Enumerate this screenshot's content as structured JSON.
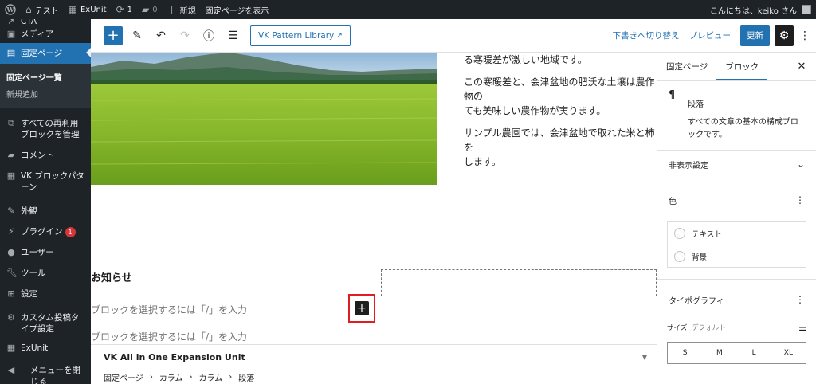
{
  "admin_bar": {
    "wp_logo_icon": "wordpress-logo-icon",
    "site_name": "テスト",
    "exunit": "ExUnit",
    "updates_count": "1",
    "comments_count": "0",
    "new_label": "新規",
    "view_page": "固定ページを表示",
    "greeting": "こんにちは、keiko さん"
  },
  "admin_menu": {
    "cta_partial": "CTA",
    "media": "メディア",
    "pages": "固定ページ",
    "pages_sub": [
      "固定ページ一覧",
      "新規追加"
    ],
    "reusable": "すべての再利用ブロックを管理",
    "comments": "コメント",
    "vk_patterns": "VK ブロックパターン",
    "appearance": "外観",
    "plugins": "プラグイン",
    "plugins_badge": "1",
    "users": "ユーザー",
    "tools": "ツール",
    "settings": "設定",
    "custom_post": "カスタム投稿タイプ設定",
    "exunit": "ExUnit",
    "collapse": "メニューを閉じる"
  },
  "editor_header": {
    "pattern_library": "VK Pattern Library",
    "switch_to_draft": "下書きへ切り替え",
    "preview": "プレビュー",
    "update": "更新"
  },
  "content": {
    "paragraphs": [
      "る寒暖差が激しい地域です。",
      "この寒暖差と、会津盆地の肥沃な土壌は農作物の\nても美味しい農作物が実ります。",
      "サンプル農園では、会津盆地で取れた米と柿を\nします。"
    ],
    "news_heading": "お知らせ",
    "placeholder": "ブロックを選択するには「/」を入力"
  },
  "metabox": {
    "title": "VK All in One Expansion Unit"
  },
  "breadcrumb": [
    "固定ページ",
    "カラム",
    "カラム",
    "段落"
  ],
  "sidebar": {
    "tabs": [
      "固定ページ",
      "ブロック"
    ],
    "block_title": "段落",
    "block_desc": "すべての文章の基本の構成ブロックです。",
    "hidden_settings": "非表示設定",
    "color": "色",
    "color_items": [
      "テキスト",
      "背景"
    ],
    "typography": "タイポグラフィ",
    "size_label": "サイズ",
    "size_value": "デフォルト",
    "size_options": [
      "S",
      "M",
      "L",
      "XL"
    ]
  },
  "colors": {
    "admin_dark": "#1d2327",
    "accent": "#2271b1",
    "highlight_red": "#e11d21"
  }
}
